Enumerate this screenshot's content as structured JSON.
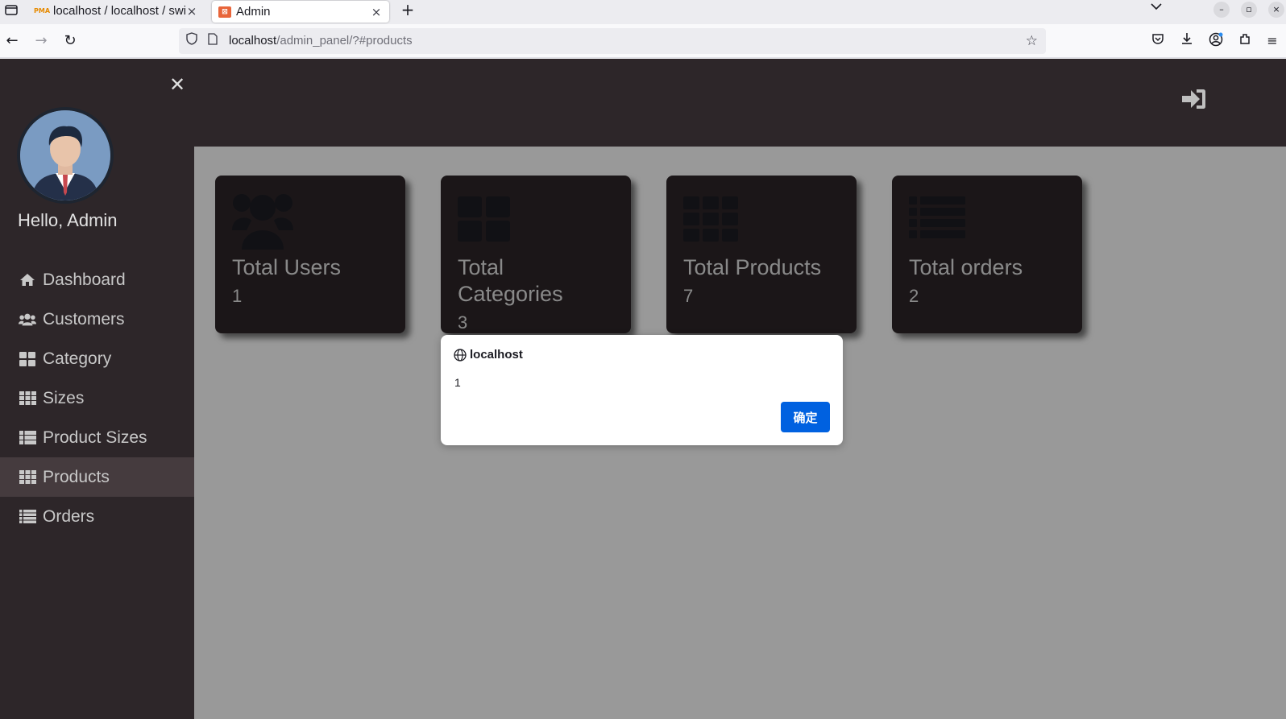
{
  "browser": {
    "tabs": [
      {
        "title": "localhost / localhost / swi",
        "favicon": "PMA"
      },
      {
        "title": "Admin",
        "favicon": "admin-favicon"
      }
    ],
    "url_host": "localhost",
    "url_path": "/admin_panel/?#products"
  },
  "sidebar": {
    "greeting": "Hello, Admin",
    "items": [
      {
        "label": "Dashboard",
        "icon": "home-icon"
      },
      {
        "label": "Customers",
        "icon": "users-icon"
      },
      {
        "label": "Category",
        "icon": "th-large-icon"
      },
      {
        "label": "Sizes",
        "icon": "th-icon"
      },
      {
        "label": "Product Sizes",
        "icon": "th-list-icon"
      },
      {
        "label": "Products",
        "icon": "th-icon"
      },
      {
        "label": "Orders",
        "icon": "list-icon"
      }
    ],
    "active_item": "Products"
  },
  "cards": [
    {
      "title": "Total Users",
      "value": "1",
      "icon": "users-icon"
    },
    {
      "title": "Total Categories",
      "value": "3",
      "icon": "th-large-icon"
    },
    {
      "title": "Total Products",
      "value": "7",
      "icon": "th-icon"
    },
    {
      "title": "Total orders",
      "value": "2",
      "icon": "th-list-icon"
    }
  ],
  "dialog": {
    "origin": "localhost",
    "message": "1",
    "ok_label": "确定"
  },
  "colors": {
    "sidebar_bg": "#2d2629",
    "active_item_bg": "#453b3e",
    "dialog_button": "#0061e0"
  }
}
